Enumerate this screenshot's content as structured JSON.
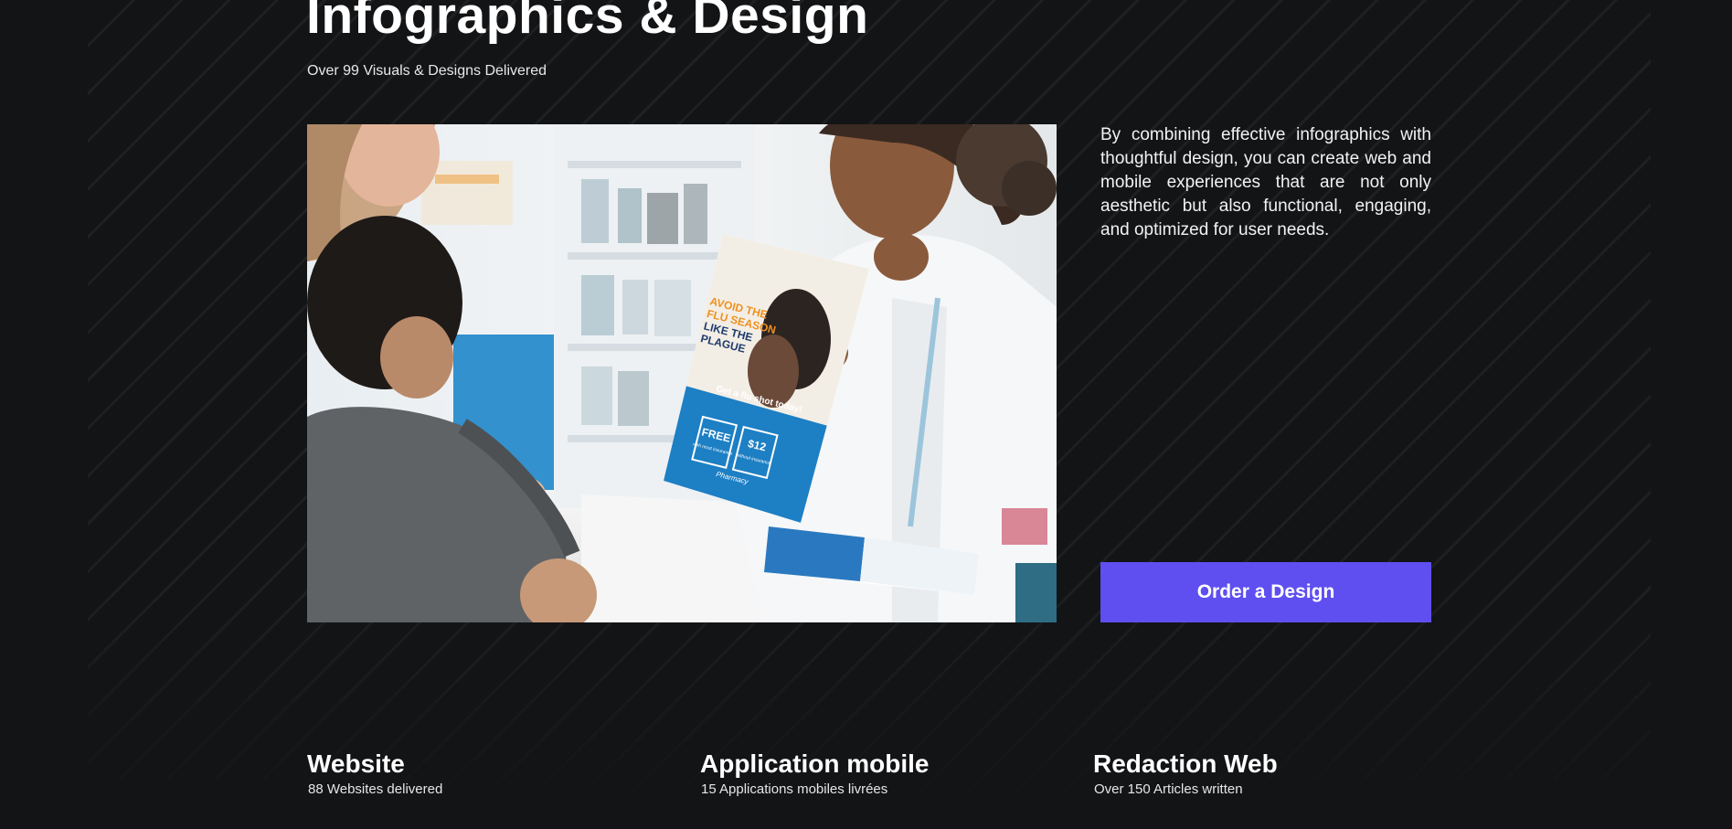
{
  "header": {
    "title": "Infographics & Design",
    "subtitle": "Over 99 Visuals & Designs Delivered"
  },
  "hero": {
    "flyer": {
      "headline_lines": [
        "AVOID THE",
        "FLU SEASON",
        "LIKE THE",
        "PLAGUE"
      ],
      "cta": "Get a flu shot today!",
      "box_free_big": "FREE",
      "box_free_small": "with most insurance",
      "box_price_big": "$12",
      "box_price_small": "without insurance",
      "brand": "Pharmacy"
    }
  },
  "description": "By combining effective infographics with thoughtful design, you can create web and mobile experiences that are not only aesthetic but also functional, engaging, and optimized for user needs.",
  "cta_label": "Order a Design",
  "stats": [
    {
      "title": "Website",
      "detail": "88 Websites delivered"
    },
    {
      "title": "Application mobile",
      "detail": "15 Applications mobiles livrées"
    },
    {
      "title": "Redaction Web",
      "detail": "Over 150 Articles written"
    }
  ],
  "colors": {
    "background": "#131416",
    "accent": "#5f4ff0",
    "text": "#ffffff"
  }
}
